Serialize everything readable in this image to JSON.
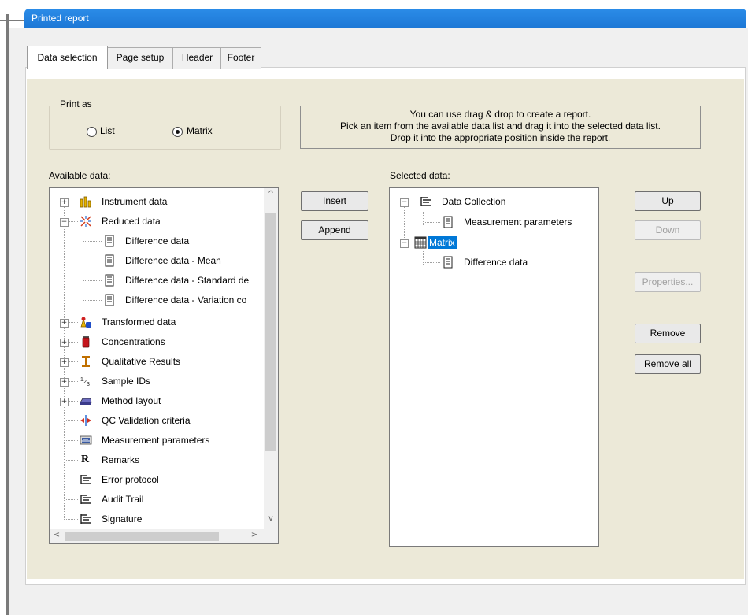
{
  "window": {
    "title": "Printed report"
  },
  "tabs": [
    {
      "label": "Data selection",
      "active": true
    },
    {
      "label": "Page setup",
      "active": false
    },
    {
      "label": "Header",
      "active": false
    },
    {
      "label": "Footer",
      "active": false
    }
  ],
  "print_as": {
    "label": "Print as",
    "options": [
      {
        "label": "List",
        "checked": false
      },
      {
        "label": "Matrix",
        "checked": true
      }
    ]
  },
  "hint": {
    "lines": [
      "You can use drag & drop to create a report.",
      "Pick an item from the available data list and drag it into the selected data list.",
      "Drop it into the appropriate position inside the report."
    ]
  },
  "available": {
    "label": "Available data:",
    "items": [
      {
        "label": "Instrument data",
        "icon": "instrument-data-icon",
        "expander": "+"
      },
      {
        "label": "Reduced data",
        "icon": "reduced-data-icon",
        "expander": "-"
      },
      {
        "label": "Difference data",
        "icon": "document-icon"
      },
      {
        "label": "Difference data - Mean",
        "icon": "document-icon"
      },
      {
        "label": "Difference data - Standard de",
        "icon": "document-icon"
      },
      {
        "label": "Difference data - Variation co",
        "icon": "document-icon"
      },
      {
        "label": "Transformed data",
        "icon": "transformed-data-icon",
        "expander": "+"
      },
      {
        "label": "Concentrations",
        "icon": "concentrations-icon",
        "expander": "+"
      },
      {
        "label": "Qualitative Results",
        "icon": "qualitative-results-icon",
        "expander": "+"
      },
      {
        "label": "Sample IDs",
        "icon": "sample-ids-icon",
        "expander": "+"
      },
      {
        "label": "Method layout",
        "icon": "method-layout-icon",
        "expander": "+"
      },
      {
        "label": "QC Validation criteria",
        "icon": "qc-validation-icon"
      },
      {
        "label": "Measurement parameters",
        "icon": "measurement-parameters-icon"
      },
      {
        "label": "Remarks",
        "icon": "remarks-icon",
        "glyph": "R"
      },
      {
        "label": "Error protocol",
        "icon": "list-icon"
      },
      {
        "label": "Audit Trail",
        "icon": "list-icon"
      },
      {
        "label": "Signature",
        "icon": "list-icon"
      }
    ]
  },
  "selected": {
    "label": "Selected data:",
    "items": [
      {
        "label": "Data Collection",
        "icon": "list-icon",
        "expander": "-"
      },
      {
        "label": "Measurement parameters",
        "icon": "document-icon"
      },
      {
        "label": "Matrix",
        "icon": "matrix-icon",
        "expander": "-",
        "selected": true
      },
      {
        "label": "Difference data",
        "icon": "document-icon"
      }
    ]
  },
  "buttons": {
    "insert": "Insert",
    "append": "Append",
    "up": "Up",
    "down": "Down",
    "properties": "Properties...",
    "remove": "Remove",
    "remove_all": "Remove all"
  },
  "scroll_glyphs": {
    "up": "^",
    "down": "v",
    "left": "<",
    "right": ">"
  },
  "colors": {
    "titlebar": "#1d78d6",
    "selection": "#0078d7",
    "dialog_bg": "#ece9d8"
  }
}
